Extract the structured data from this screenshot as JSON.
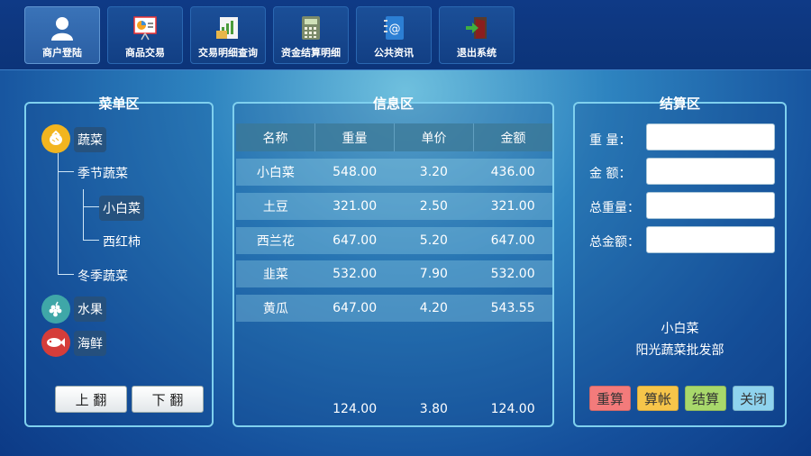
{
  "toolbar": {
    "items": [
      {
        "label": "商户登陆",
        "icon": "user-icon"
      },
      {
        "label": "商品交易",
        "icon": "presentation-icon"
      },
      {
        "label": "交易明细查询",
        "icon": "report-icon"
      },
      {
        "label": "资金结算明细",
        "icon": "calculator-icon"
      },
      {
        "label": "公共资讯",
        "icon": "address-book-icon"
      },
      {
        "label": "退出系统",
        "icon": "exit-icon"
      }
    ],
    "active_index": 0
  },
  "menu": {
    "title": "菜单区",
    "categories": [
      {
        "label": "蔬菜",
        "icon": "vegetable-icon",
        "color": "#f2b51f"
      },
      {
        "label": "水果",
        "icon": "grape-icon",
        "color": "#3fa7a8"
      },
      {
        "label": "海鲜",
        "icon": "fish-icon",
        "color": "#d53d3a"
      }
    ],
    "subitems": {
      "seasonal": "季节蔬菜",
      "winter": "冬季蔬菜",
      "bok_choy": "小白菜",
      "tomato": "西红柿"
    },
    "page_up": "上 翻",
    "page_down": "下 翻"
  },
  "info": {
    "title": "信息区",
    "columns": [
      "名称",
      "重量",
      "单价",
      "金额"
    ],
    "rows": [
      [
        "小白菜",
        "548.00",
        "3.20",
        "436.00"
      ],
      [
        "土豆",
        "321.00",
        "2.50",
        "321.00"
      ],
      [
        "西兰花",
        "647.00",
        "5.20",
        "647.00"
      ],
      [
        "韭菜",
        "532.00",
        "7.90",
        "532.00"
      ],
      [
        "黄瓜",
        "647.00",
        "4.20",
        "543.55"
      ]
    ],
    "footer": [
      "",
      "124.00",
      "3.80",
      "124.00"
    ]
  },
  "calc": {
    "title": "结算区",
    "fields": [
      {
        "label": "重  量：",
        "value": ""
      },
      {
        "label": "金  额：",
        "value": ""
      },
      {
        "label": "总重量：",
        "value": ""
      },
      {
        "label": "总金额：",
        "value": ""
      }
    ],
    "product": "小白菜",
    "vendor": "阳光蔬菜批发部",
    "buttons": [
      {
        "label": "重算",
        "color": "#f37b7b"
      },
      {
        "label": "算帐",
        "color": "#f6c54a"
      },
      {
        "label": "结算",
        "color": "#a8d86b"
      },
      {
        "label": "关闭",
        "color": "#8fd3ee"
      }
    ]
  }
}
